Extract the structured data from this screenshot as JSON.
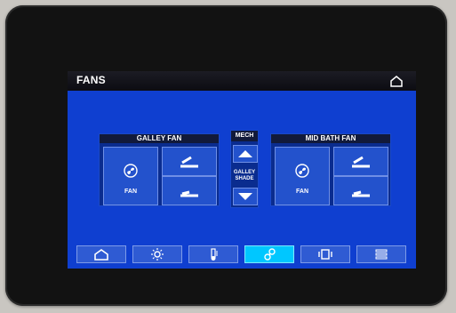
{
  "app": {
    "title": "FANS"
  },
  "panels": {
    "galley_fan": {
      "title": "GALLEY FAN",
      "fan_button_label": "FAN"
    },
    "mech": {
      "title": "MECH",
      "galley_shade_label_line1": "GALLEY",
      "galley_shade_label_line2": "SHADE"
    },
    "mid_bath_fan": {
      "title": "MID BATH FAN",
      "fan_button_label": "FAN"
    }
  },
  "navbar": {
    "items": [
      {
        "icon": "home-icon"
      },
      {
        "icon": "lightbulb-icon"
      },
      {
        "icon": "thermometer-icon"
      },
      {
        "icon": "fan-icon"
      },
      {
        "icon": "slideout-icon"
      },
      {
        "icon": "settings-list-icon"
      }
    ],
    "active_index": 3
  },
  "colors": {
    "screen_bg": "#0f3fd0",
    "panel_bg": "#0a2c8f",
    "button_bg": "#2352cc",
    "active_tab": "#00c7ff"
  }
}
